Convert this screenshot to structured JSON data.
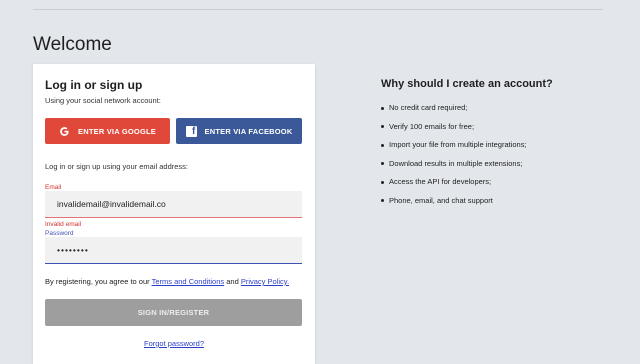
{
  "page": {
    "title": "Welcome"
  },
  "login_card": {
    "title": "Log in or sign up",
    "social_caption": "Using your social network account:",
    "google_button": {
      "label": "ENTER VIA GOOGLE",
      "icon": "google-g-icon",
      "color": "#e0483a"
    },
    "facebook_button": {
      "label": "ENTER VIA FACEBOOK",
      "icon": "facebook-f-icon",
      "color": "#3b5998"
    },
    "email_caption": "Log in or sign up using your email address:",
    "email_field": {
      "label": "Email",
      "value": "invalidemail@invalidemail.co",
      "error": "Invalid email"
    },
    "password_field": {
      "label": "Password",
      "value": "••••••••"
    },
    "terms": {
      "prefix": "By registering, you agree to our ",
      "terms_link": "Terms and Conditions",
      "middle": " and ",
      "privacy_link": "Privacy Policy."
    },
    "submit_button": {
      "label": "SIGN IN/REGISTER",
      "state": "disabled"
    },
    "forgot_link": "Forgot password?"
  },
  "benefits": {
    "title": "Why should I create an account?",
    "items": [
      "No credit card required;",
      "Verify 100 emails for free;",
      "Import your file from multiple integrations;",
      "Download results in multiple extensions;",
      "Access the API for developers;",
      "Phone, email, and chat support"
    ]
  },
  "colors": {
    "background": "#e3e7ec",
    "error": "#d32f2f",
    "focus": "#3f51b5",
    "link": "#2c3fc8"
  }
}
